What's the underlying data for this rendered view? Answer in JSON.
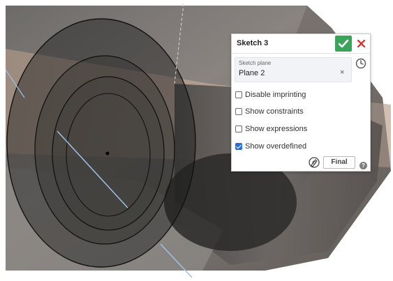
{
  "panel": {
    "title": "Sketch 3",
    "accept_icon": "checkmark-icon",
    "close_icon": "close-icon",
    "sketch_plane": {
      "label": "Sketch plane",
      "value": "Plane 2",
      "clear_glyph": "×"
    },
    "history_icon": "clock-icon",
    "options": [
      {
        "label": "Disable imprinting",
        "checked": false
      },
      {
        "label": "Show constraints",
        "checked": false
      },
      {
        "label": "Show expressions",
        "checked": false
      },
      {
        "label": "Show overdefined",
        "checked": true
      }
    ],
    "tool_icon": "sketch-tool-icon",
    "final_label": "Final",
    "help_glyph": "?"
  },
  "colors": {
    "accept_green": "#3aa55a",
    "close_red": "#d62b2b",
    "checkbox_blue": "#2a6fd6"
  }
}
